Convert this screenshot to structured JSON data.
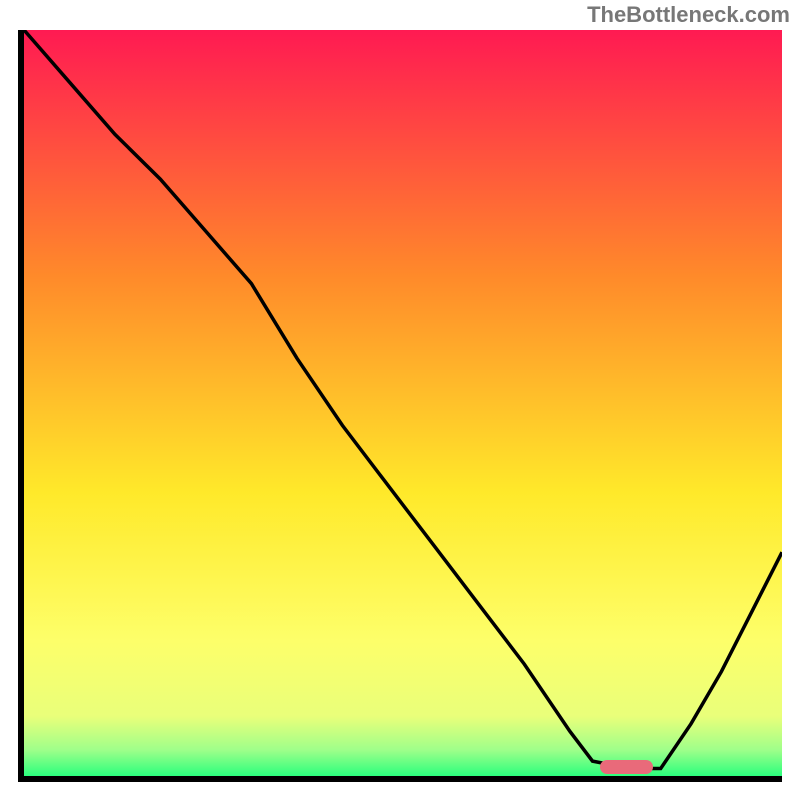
{
  "watermark": "TheBottleneck.com",
  "chart_data": {
    "type": "line",
    "title": "",
    "xlabel": "",
    "ylabel": "",
    "xlim": [
      0,
      100
    ],
    "ylim": [
      0,
      100
    ],
    "gradient_stops": [
      {
        "offset": 0,
        "color": "#ff1a52"
      },
      {
        "offset": 0.33,
        "color": "#ff8a2a"
      },
      {
        "offset": 0.62,
        "color": "#ffe92a"
      },
      {
        "offset": 0.82,
        "color": "#fdff6a"
      },
      {
        "offset": 0.92,
        "color": "#e9ff7a"
      },
      {
        "offset": 0.965,
        "color": "#9fff8a"
      },
      {
        "offset": 1.0,
        "color": "#2bff7d"
      }
    ],
    "x": [
      0,
      6,
      12,
      18,
      24,
      30,
      36,
      42,
      48,
      54,
      60,
      66,
      72,
      75,
      80,
      84,
      88,
      92,
      96,
      100
    ],
    "y": [
      100,
      93,
      86,
      80,
      73,
      66,
      56,
      47,
      39,
      31,
      23,
      15,
      6,
      2,
      1,
      1,
      7,
      14,
      22,
      30
    ],
    "marker": {
      "x_start": 76,
      "x_end": 83,
      "y": 1.2
    }
  }
}
